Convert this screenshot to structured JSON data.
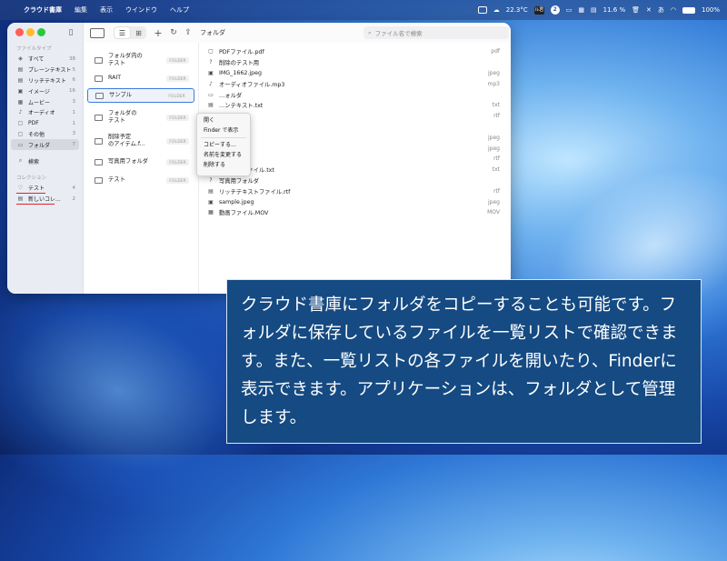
{
  "menubar": {
    "apple": "",
    "items": [
      "クラウド書庫",
      "編集",
      "表示",
      "ウインドウ",
      "ヘルプ"
    ],
    "status": {
      "weather": "22.3°C",
      "badge_dark": "ル君",
      "badge_circle": "2",
      "battery_text": "11.6 %",
      "battery_level": "100%",
      "jp_badge": "あ"
    }
  },
  "window": {
    "title": "フォルダ",
    "search_placeholder": "ファイル名で検索"
  },
  "sidebar": {
    "section_filetype": "ファイルタイプ",
    "filetypes": [
      {
        "icon": "layers-icon",
        "glyph": "◈",
        "label": "すべて",
        "count": "38"
      },
      {
        "icon": "doc-icon",
        "glyph": "▤",
        "label": "プレーンテキスト",
        "count": "5"
      },
      {
        "icon": "rich-doc-icon",
        "glyph": "▤",
        "label": "リッチテキスト",
        "count": "6"
      },
      {
        "icon": "image-icon",
        "glyph": "▣",
        "label": "イメージ",
        "count": "16"
      },
      {
        "icon": "movie-icon",
        "glyph": "▦",
        "label": "ムービー",
        "count": "3"
      },
      {
        "icon": "music-icon",
        "glyph": "♪",
        "label": "オーディオ",
        "count": "1"
      },
      {
        "icon": "pdf-icon",
        "glyph": "▢",
        "label": "PDF",
        "count": "1"
      },
      {
        "icon": "other-icon",
        "glyph": "▢",
        "label": "その他",
        "count": "3"
      },
      {
        "icon": "folder-icon",
        "glyph": "▭",
        "label": "フォルダ",
        "count": "7"
      }
    ],
    "search_label": "検索",
    "section_collection": "コレクション",
    "collections": [
      {
        "icon": "heart-icon",
        "glyph": "♡",
        "label": "テスト",
        "count": "4"
      },
      {
        "icon": "collection-icon",
        "glyph": "▤",
        "label": "新しいコレ...",
        "count": "2"
      }
    ]
  },
  "folders": [
    {
      "name": "フォルダ内の\nテスト",
      "badge": "FOLDER"
    },
    {
      "name": "RAIT",
      "badge": "FOLDER"
    },
    {
      "name": "サンプル",
      "badge": "FOLDER"
    },
    {
      "name": "フォルダの\nテスト",
      "badge": "FOLDER"
    },
    {
      "name": "削除予定\nのアイテム.f...",
      "badge": "FOLDER"
    },
    {
      "name": "写真用フォルダ",
      "badge": "FOLDER"
    },
    {
      "name": "テスト",
      "badge": "FOLDER"
    }
  ],
  "files": [
    {
      "icon": "pdf-icon",
      "glyph": "▢",
      "name": "PDFファイル.pdf",
      "ext": "pdf"
    },
    {
      "icon": "other-icon",
      "glyph": "?",
      "name": "削除のテスト用",
      "ext": ""
    },
    {
      "icon": "image-icon",
      "glyph": "▣",
      "name": "IMG_1662.jpeg",
      "ext": "jpeg"
    },
    {
      "icon": "music-icon",
      "glyph": "♪",
      "name": "オーディオファイル.mp3",
      "ext": "mp3"
    },
    {
      "icon": "folder-icon",
      "glyph": "▭",
      "name": "…ォルダ",
      "ext": ""
    },
    {
      "icon": "doc-icon",
      "glyph": "▤",
      "name": "…ンテキスト.txt",
      "ext": "txt"
    },
    {
      "icon": "rich-doc-icon",
      "glyph": "▤",
      "name": "…ト用.rtf",
      "ext": "rtf"
    },
    {
      "icon": "doc-icon",
      "glyph": "▤",
      "name": "…テスト",
      "ext": ""
    },
    {
      "icon": "image-icon",
      "glyph": "▣",
      "name": "…jpeg",
      "ext": "jpeg"
    },
    {
      "icon": "image-icon",
      "glyph": "▣",
      "name": "…jpeg",
      "ext": "jpeg"
    },
    {
      "icon": "rich-doc-icon",
      "glyph": "▤",
      "name": "…スト.rtf",
      "ext": "rtf"
    },
    {
      "icon": "doc-icon",
      "glyph": "▤",
      "name": "テキストファイル.txt",
      "ext": "txt"
    },
    {
      "icon": "other-icon",
      "glyph": "?",
      "name": "写真用フォルダ",
      "ext": ""
    },
    {
      "icon": "rich-doc-icon",
      "glyph": "▤",
      "name": "リッチテキストファイル.rtf",
      "ext": "rtf"
    },
    {
      "icon": "image-icon",
      "glyph": "▣",
      "name": "sample.jpeg",
      "ext": "jpeg"
    },
    {
      "icon": "movie-icon",
      "glyph": "▦",
      "name": "動画ファイル.MOV",
      "ext": "MOV"
    }
  ],
  "context_menu": {
    "open": "開く",
    "show_in_finder": "Finder で表示",
    "copy": "コピーする...",
    "rename": "名前を変更する",
    "delete": "削除する"
  },
  "caption": "クラウド書庫にフォルダをコピーすることも可能です。フォルダに保存しているファイルを一覧リストで確認できます。また、一覧リストの各ファイルを開いたり、Finderに表示できます。アプリケーションは、フォルダとして管理します。",
  "colors": {
    "accent": "#3a7be0",
    "underline": "#e0262e",
    "caption_bg": "#154a82"
  }
}
